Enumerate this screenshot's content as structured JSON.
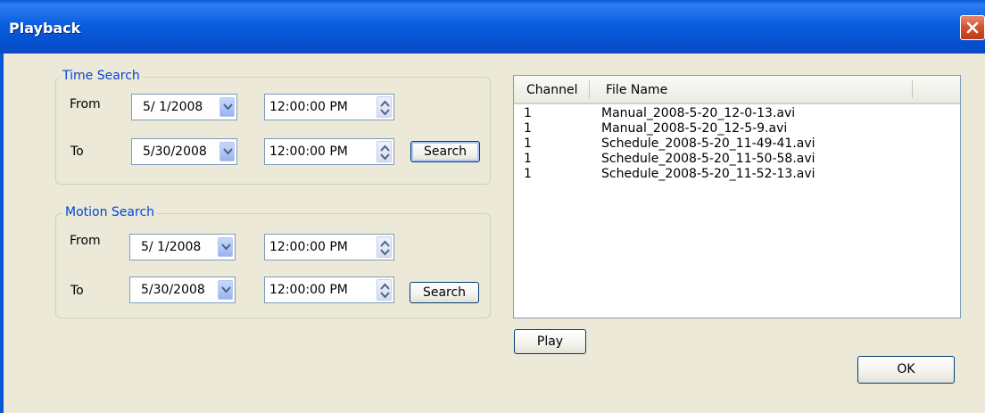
{
  "window": {
    "title": "Playback"
  },
  "time_search": {
    "group_label": "Time Search",
    "from_label": "From",
    "to_label": "To",
    "from_date": "5/ 1/2008",
    "from_time": "12:00:00 PM",
    "to_date": "5/30/2008",
    "to_time": "12:00:00 PM",
    "search_label": "Search"
  },
  "motion_search": {
    "group_label": "Motion Search",
    "from_label": "From",
    "to_label": "To",
    "from_date": "5/ 1/2008",
    "from_time": "12:00:00 PM",
    "to_date": "5/30/2008",
    "to_time": "12:00:00 PM",
    "search_label": "Search"
  },
  "file_list": {
    "columns": [
      "Channel",
      "File Name"
    ],
    "rows": [
      {
        "channel": "1",
        "file": "Manual_2008-5-20_12-0-13.avi"
      },
      {
        "channel": "1",
        "file": "Manual_2008-5-20_12-5-9.avi"
      },
      {
        "channel": "1",
        "file": "Schedule_2008-5-20_11-49-41.avi"
      },
      {
        "channel": "1",
        "file": "Schedule_2008-5-20_11-50-58.avi"
      },
      {
        "channel": "1",
        "file": "Schedule_2008-5-20_11-52-13.avi"
      }
    ]
  },
  "buttons": {
    "play": "Play",
    "ok": "OK"
  },
  "icons": {
    "close": "close-icon",
    "dropdown": "chevron-down-icon",
    "spin": "spin-updown-icon"
  },
  "colors": {
    "titlebar": "#0a58d6",
    "group_label": "#0046d5",
    "close": "#d4502c"
  }
}
